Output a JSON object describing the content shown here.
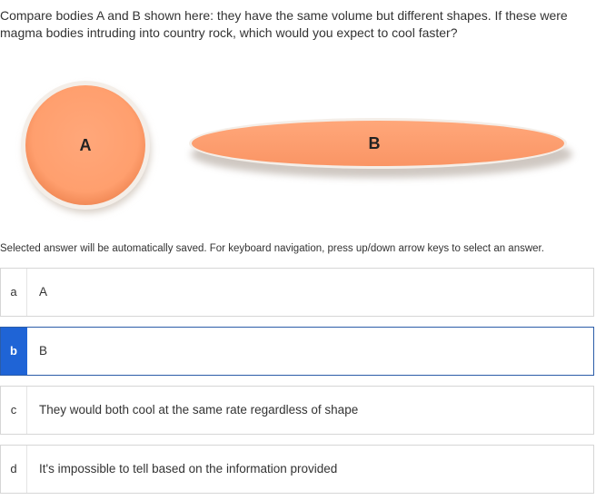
{
  "question": {
    "text": "Compare bodies A and B shown here: they have the same volume but different shapes. If these were magma bodies intruding into country rock, which would you expect to cool faster?"
  },
  "figure": {
    "fill_color": "#FF9F6E",
    "shapes": [
      {
        "label": "A",
        "shape": "circle"
      },
      {
        "label": "B",
        "shape": "ellipse"
      }
    ]
  },
  "instructions": "Selected answer will be automatically saved. For keyboard navigation, press up/down arrow keys to select an answer.",
  "options": [
    {
      "letter": "a",
      "text": "A",
      "selected": false
    },
    {
      "letter": "b",
      "text": "B",
      "selected": true
    },
    {
      "letter": "c",
      "text": "They would both cool at the same rate regardless of shape",
      "selected": false
    },
    {
      "letter": "d",
      "text": "It's impossible to tell based on the information provided",
      "selected": false
    }
  ],
  "colors": {
    "selected_accent": "#1F64D6",
    "selected_border": "#2B5CA8",
    "option_border": "#D6D6D6"
  }
}
